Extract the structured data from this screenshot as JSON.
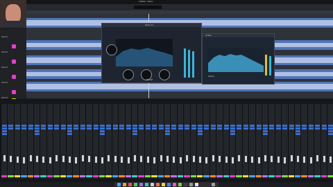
{
  "menubar": {
    "title": "Untitled - Tracks"
  },
  "plugin1": {
    "title": "Ozone 11",
    "preset_label": "Default"
  },
  "plugin2": {
    "title": "Limiter",
    "mode_label": "Ceiling"
  },
  "tracks": [
    {
      "name": "Vocal 1"
    },
    {
      "name": "Vocal 2"
    },
    {
      "name": "Vocal 3"
    },
    {
      "name": "Vocal 4"
    },
    {
      "name": "Vocal 5"
    }
  ],
  "colors": {
    "accent": "#4f74b8",
    "record": "#e040c8",
    "meter": "#39b6d8",
    "solo_yellow": "#d8e000"
  }
}
